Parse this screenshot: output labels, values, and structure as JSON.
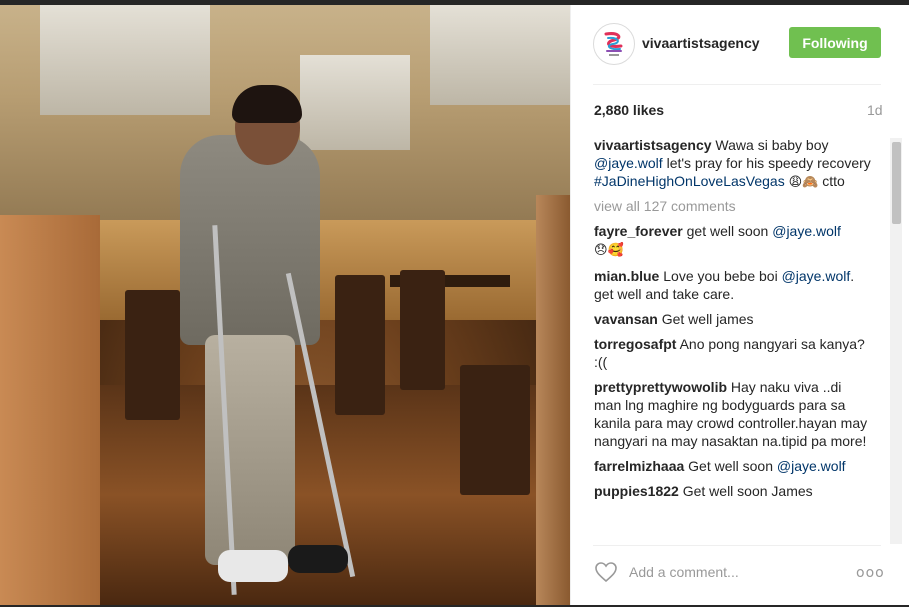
{
  "header": {
    "username": "vivaartistsagency",
    "follow_label": "Following",
    "avatar_icon": "viva-logo-icon"
  },
  "stats": {
    "likes": "2,880 likes",
    "time": "1d"
  },
  "caption": {
    "user": "vivaartistsagency",
    "text_1": "Wawa si baby boy ",
    "mention": "@jaye.wolf",
    "text_2": " let's pray for his speedy recovery ",
    "hashtag": "#JaDineHighOnLoveLasVegas",
    "emoji": "😩🙈",
    "text_3": " ctto"
  },
  "view_all": "view all 127 comments",
  "comments": [
    {
      "user": "fayre_forever",
      "text": "get well soon ",
      "mention": "@jaye.wolf",
      "after": "",
      "emoji": "😞🥰"
    },
    {
      "user": "mian.blue",
      "text": "Love you bebe boi ",
      "mention": "@jaye.wolf",
      "after": ". get well and take care.",
      "emoji": ""
    },
    {
      "user": "vavansan",
      "text": "Get well james",
      "mention": "",
      "after": "",
      "emoji": ""
    },
    {
      "user": "torregosafpt",
      "text": "Ano pong nangyari sa kanya? :((",
      "mention": "",
      "after": "",
      "emoji": ""
    },
    {
      "user": "prettyprettywowolib",
      "text": "Hay naku viva ..di man lng maghire ng bodyguards para sa kanila para may crowd controller.hayan may nangyari na may nasaktan na.tipid pa more!",
      "mention": "",
      "after": "",
      "emoji": ""
    },
    {
      "user": "farrelmizhaaa",
      "text": "Get well soon ",
      "mention": "@jaye.wolf",
      "after": "",
      "emoji": ""
    },
    {
      "user": "puppies1822",
      "text": "Get well soon James",
      "mention": "",
      "after": "",
      "emoji": ""
    }
  ],
  "footer": {
    "placeholder": "Add a comment...",
    "like_icon": "heart-icon",
    "more_label": "ooo"
  },
  "colors": {
    "follow_green": "#70c050",
    "link_blue": "#003569",
    "muted": "#999999"
  }
}
